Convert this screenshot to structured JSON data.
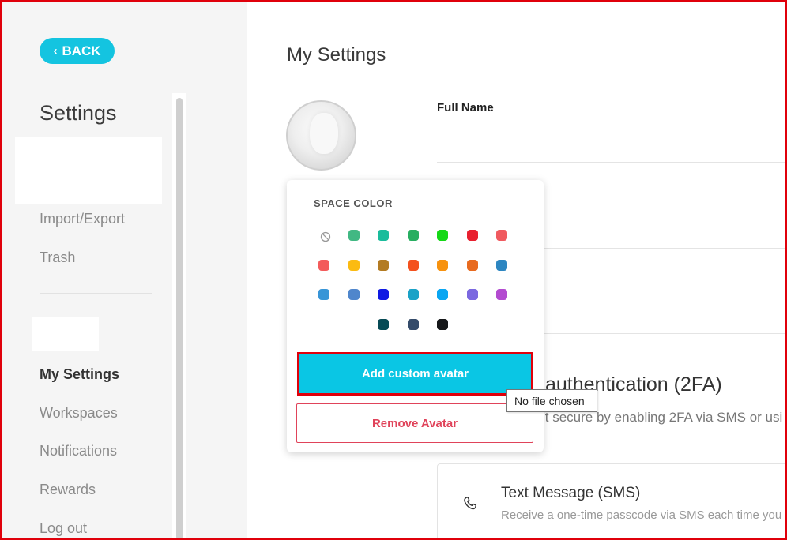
{
  "sidebar": {
    "back_label": "BACK",
    "title": "Settings",
    "items": [
      {
        "label": "Import/Export"
      },
      {
        "label": "Trash"
      },
      {
        "label": "My Settings"
      },
      {
        "label": "Workspaces"
      },
      {
        "label": "Notifications"
      },
      {
        "label": "Rewards"
      },
      {
        "label": "Log out"
      }
    ]
  },
  "main": {
    "title": "My Settings",
    "full_name_label": "Full Name",
    "twofa": {
      "title": "authentication (2FA)",
      "description": "it secure by enabling 2FA via SMS or usi"
    },
    "sms": {
      "title": "Text Message (SMS)",
      "description": "Receive a one-time passcode via SMS each time you lo"
    }
  },
  "popover": {
    "heading": "SPACE COLOR",
    "no_color_icon": "no-color-icon",
    "colors": [
      [
        "#41b883",
        "#1abc9c",
        "#27ae60",
        "#15d817",
        "#e8202f",
        "#f05a5f"
      ],
      [
        "#f35b5b",
        "#fbbb11",
        "#b37b22",
        "#f4511e",
        "#f7920f",
        "#e86a1f",
        "#2d86c1"
      ],
      [
        "#3795d7",
        "#4f86cc",
        "#0f19e3",
        "#1aa2c7",
        "#0aa6f2",
        "#7b68e0",
        "#b34bd0"
      ],
      [
        "#064a55",
        "#344b6a",
        "#16181a"
      ]
    ],
    "add_label": "Add custom avatar",
    "remove_label": "Remove Avatar"
  },
  "tooltip": {
    "text": "No file chosen"
  },
  "accent": "#14c4e0",
  "danger": "#e0435a"
}
